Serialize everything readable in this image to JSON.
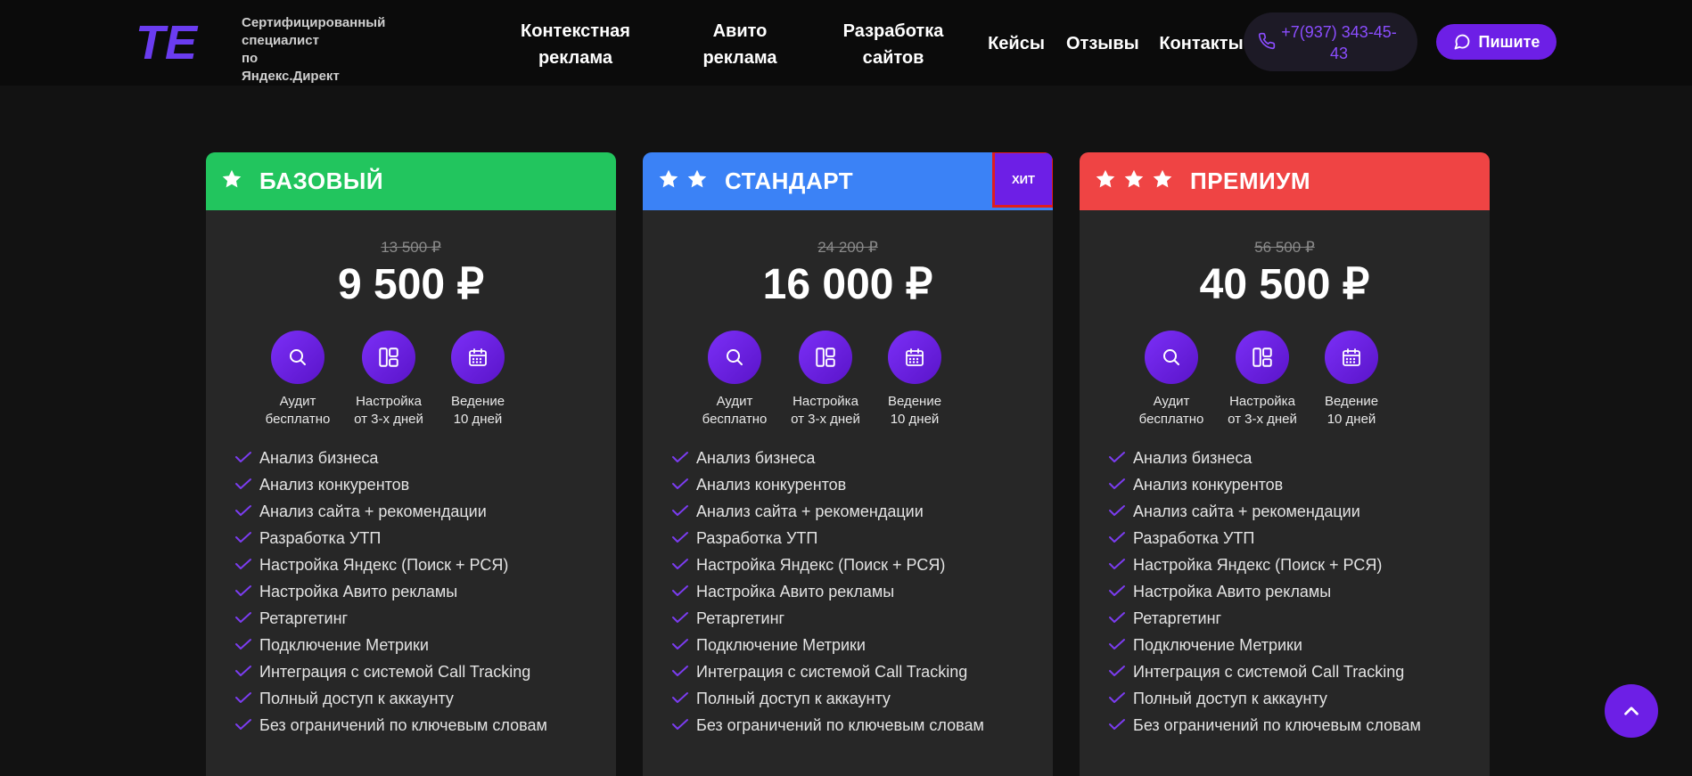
{
  "header": {
    "logo_text": "TE",
    "caption": [
      "Сертифицированный специалист",
      "по",
      "Яндекс.Директ"
    ],
    "nav": [
      {
        "line1": "Контекстная",
        "line2": "реклама"
      },
      {
        "line1": "Авито",
        "line2": "реклама"
      },
      {
        "line1": "Разработка",
        "line2": "сайтов"
      },
      {
        "line1": "Кейсы",
        "line2": ""
      },
      {
        "line1": "Отзывы",
        "line2": ""
      },
      {
        "line1": "Контакты",
        "line2": ""
      }
    ],
    "phone_line1": "+7(937) 343-45-",
    "phone_line2": "43",
    "write_label": "Пишите"
  },
  "colors": {
    "accent": "#6d1fe6",
    "basic": "#22c55e",
    "standard": "#3b82f6",
    "premium": "#ef4444"
  },
  "plans": [
    {
      "title": "БАЗОВЫЙ",
      "stars": 1,
      "old_price": "13 500 ₽",
      "price": "9 500 ₽",
      "badge": "",
      "features": [
        {
          "icon": "search-icon",
          "line1": "Аудит",
          "line2": "бесплатно"
        },
        {
          "icon": "layout-icon",
          "line1": "Настройка",
          "line2": "от 3-х дней"
        },
        {
          "icon": "calendar-icon",
          "line1": "Ведение",
          "line2": "10 дней"
        }
      ],
      "items": [
        "Анализ бизнеса",
        "Анализ конкурентов",
        "Анализ сайта + рекомендации",
        "Разработка УТП",
        "Настройка Яндекс (Поиск + РСЯ)",
        "Настройка Авито рекламы",
        "Ретаргетинг",
        "Подключение Метрики",
        "Интеграция с системой Call Tracking",
        "Полный доступ к аккаунту",
        "Без ограничений по ключевым словам"
      ]
    },
    {
      "title": "СТАНДАРТ",
      "stars": 2,
      "old_price": "24 200 ₽",
      "price": "16 000 ₽",
      "badge": "ХИТ",
      "features": [
        {
          "icon": "search-icon",
          "line1": "Аудит",
          "line2": "бесплатно"
        },
        {
          "icon": "layout-icon",
          "line1": "Настройка",
          "line2": "от 3-х дней"
        },
        {
          "icon": "calendar-icon",
          "line1": "Ведение",
          "line2": "10 дней"
        }
      ],
      "items": [
        "Анализ бизнеса",
        "Анализ конкурентов",
        "Анализ сайта + рекомендации",
        "Разработка УТП",
        "Настройка Яндекс (Поиск + РСЯ)",
        "Настройка Авито рекламы",
        "Ретаргетинг",
        "Подключение Метрики",
        "Интеграция с системой Call Tracking",
        "Полный доступ к аккаунту",
        "Без ограничений по ключевым словам"
      ]
    },
    {
      "title": "ПРЕМИУМ",
      "stars": 3,
      "old_price": "56 500 ₽",
      "price": "40 500 ₽",
      "badge": "",
      "features": [
        {
          "icon": "search-icon",
          "line1": "Аудит",
          "line2": "бесплатно"
        },
        {
          "icon": "layout-icon",
          "line1": "Настройка",
          "line2": "от 3-х дней"
        },
        {
          "icon": "calendar-icon",
          "line1": "Ведение",
          "line2": "10 дней"
        }
      ],
      "items": [
        "Анализ бизнеса",
        "Анализ конкурентов",
        "Анализ сайта + рекомендации",
        "Разработка УТП",
        "Настройка Яндекс (Поиск + РСЯ)",
        "Настройка Авито рекламы",
        "Ретаргетинг",
        "Подключение Метрики",
        "Интеграция с системой Call Tracking",
        "Полный доступ к аккаунту",
        "Без ограничений по ключевым словам"
      ]
    }
  ]
}
